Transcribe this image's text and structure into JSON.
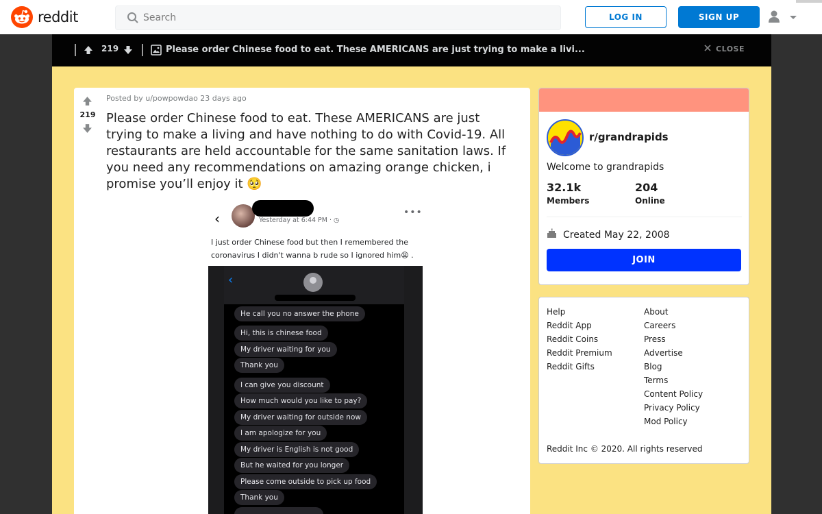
{
  "app": {
    "brand": "reddit",
    "accent": "#ff4500",
    "link_blue": "#0079d3"
  },
  "header": {
    "search_placeholder": "Search",
    "login_label": "LOG IN",
    "signup_label": "SIGN UP"
  },
  "overlay": {
    "score": "219",
    "title": "Please order Chinese food to eat. These AMERICANS are just trying to make a livi...",
    "close_label": "CLOSE"
  },
  "post": {
    "score": "219",
    "posted_by": "Posted by u/powpowdao 23 days ago",
    "title": "Please order Chinese food to eat. These AMERICANS are just trying to make a living and have nothing to do with Covid-19. All restaurants are held accountable for the same sanitation laws. If you need any recommendations on amazing orange chicken, i promise you’ll enjoy it 🥺"
  },
  "screenshot": {
    "timestamp": "Yesterday at 6:44 PM · ◷",
    "status_text": "I just order Chinese food but then I remembered the coronavirus I didn't wanna b rude so I ignored him😩 .",
    "messages": [
      "He call you no answer the phone",
      "Hi, this is chinese food",
      "My driver waiting for you",
      "Thank you",
      "I can give you discount",
      "How much would you like to pay?",
      "My driver waiting for outside now",
      "I am apologize for you",
      "My driver is English is not good",
      "But he waited for you longer",
      "Please come outside to pick up food",
      "Thank you"
    ]
  },
  "community": {
    "name": "r/grandrapids",
    "description": "Welcome to grandrapids",
    "members_count": "32.1k",
    "members_label": "Members",
    "online_count": "204",
    "online_label": "Online",
    "created": "Created May 22, 2008",
    "join_label": "JOIN",
    "banner_color": "#ff937e"
  },
  "footer": {
    "col1": [
      "Help",
      "Reddit App",
      "Reddit Coins",
      "Reddit Premium",
      "Reddit Gifts"
    ],
    "col2": [
      "About",
      "Careers",
      "Press",
      "Advertise",
      "Blog",
      "Terms",
      "Content Policy",
      "Privacy Policy",
      "Mod Policy"
    ],
    "copyright": "Reddit Inc © 2020. All rights reserved"
  }
}
